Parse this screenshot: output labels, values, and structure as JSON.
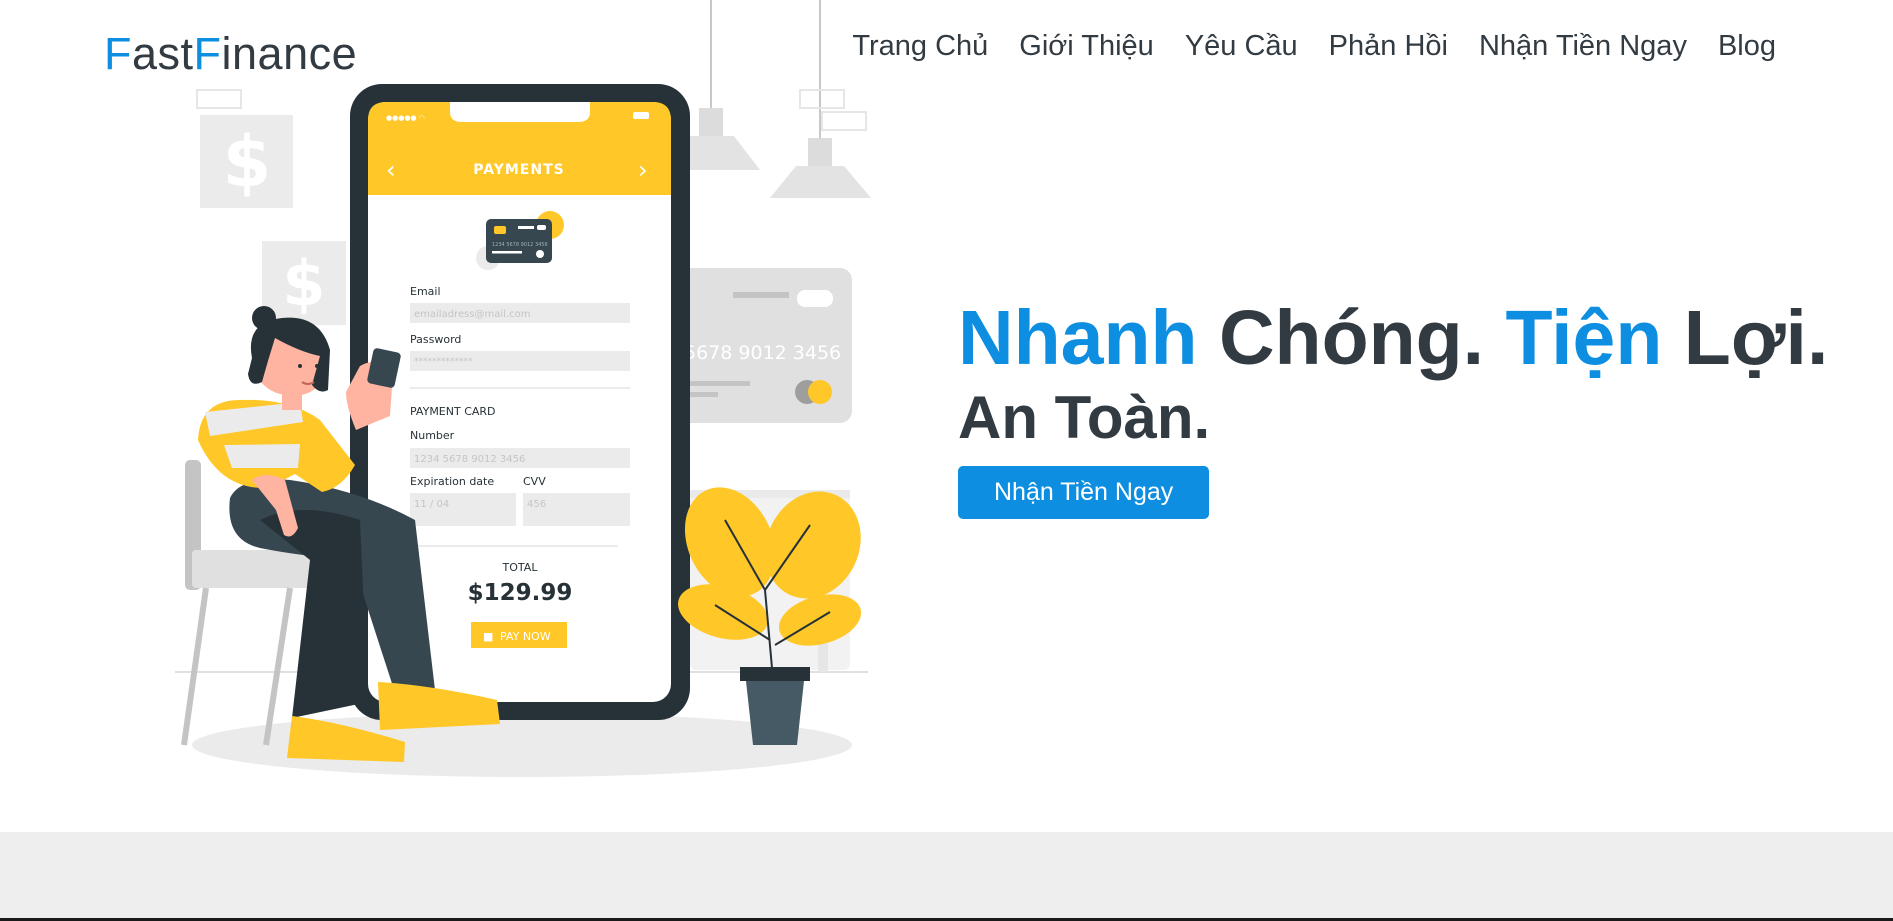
{
  "header": {
    "logo": {
      "part1": "F",
      "part2": "ast",
      "part3": "F",
      "part4": "inance"
    },
    "nav": [
      {
        "label": "Trang Chủ"
      },
      {
        "label": "Giới Thiệu"
      },
      {
        "label": "Yêu Cầu"
      },
      {
        "label": "Phản Hồi"
      },
      {
        "label": "Nhận Tiền Ngay"
      },
      {
        "label": "Blog"
      }
    ]
  },
  "hero": {
    "headline_1": "Nhanh",
    "headline_2": " Chóng. ",
    "headline_3": "Tiện",
    "headline_4": " Lợi.",
    "subline": "An Toàn.",
    "cta_label": "Nhận Tiền Ngay"
  },
  "illustration": {
    "phone_title": "PAYMENTS",
    "card_number_small": "1234 5678 9012 3456",
    "email_label": "Email",
    "email_placeholder": "emailadress@mail.com",
    "password_label": "Password",
    "password_placeholder": "*************",
    "payment_card_label": "PAYMENT CARD",
    "number_label": "Number",
    "number_placeholder": "1234 5678 9012 3456",
    "expiration_label": "Expiration date",
    "expiration_placeholder": "11 / 04",
    "cvv_label": "CVV",
    "cvv_placeholder": "456",
    "total_label": "TOTAL",
    "total_value": "$129.99",
    "pay_now_label": "PAY NOW",
    "bg_card_number": "5678 9012 3456",
    "dollar_sign": "$"
  },
  "colors": {
    "accent": "#0d8ee0",
    "text": "#333b42",
    "yellow": "#ffc727",
    "dark": "#263238"
  }
}
